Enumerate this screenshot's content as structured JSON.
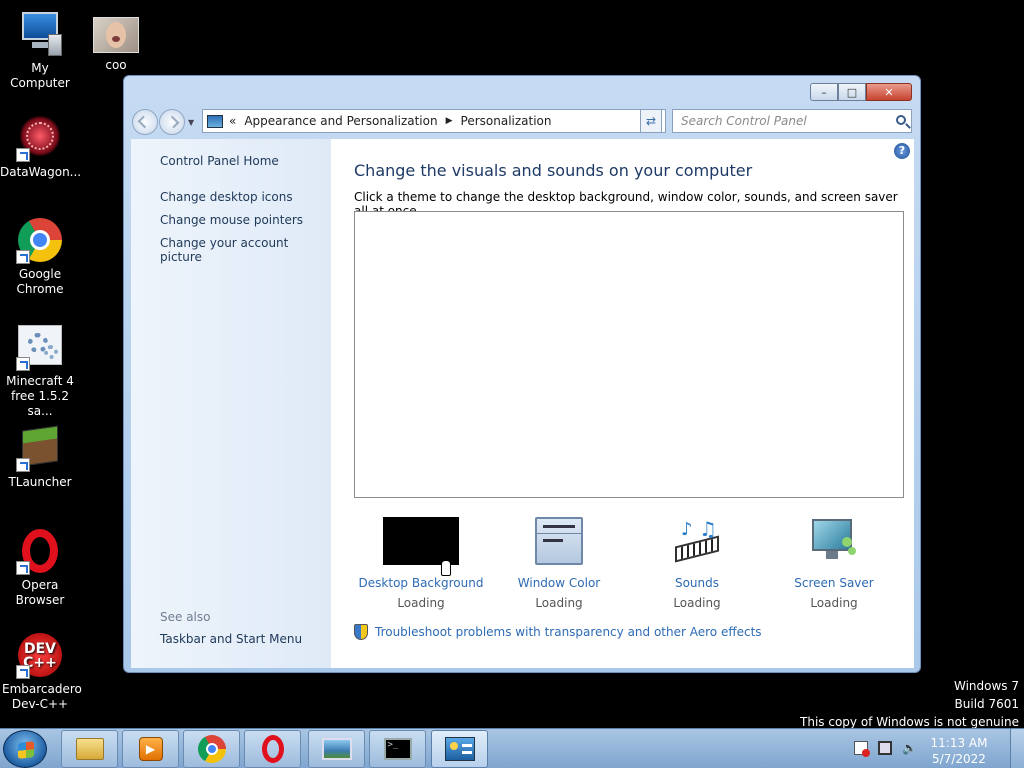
{
  "desktop": {
    "icons": [
      {
        "label": "My Computer"
      },
      {
        "label": "coo"
      },
      {
        "label": "DataWagon..."
      },
      {
        "label": "Google Chrome"
      },
      {
        "label": "Minecraft 4 free 1.5.2 sa..."
      },
      {
        "label": "TLauncher"
      },
      {
        "label": "Opera Browser"
      },
      {
        "label": "Embarcadero Dev-C++"
      }
    ]
  },
  "window": {
    "caption": {
      "minimize": "–",
      "maximize": "□",
      "close": "✕"
    },
    "address": {
      "prefix": "«",
      "crumbs": [
        "Appearance and Personalization",
        "Personalization"
      ],
      "separator": "▶"
    },
    "search": {
      "placeholder": "Search Control Panel"
    },
    "left_pane": {
      "home": "Control Panel Home",
      "links": [
        "Change desktop icons",
        "Change mouse pointers",
        "Change your account picture"
      ],
      "see_also": "See also",
      "see_also_links": [
        "Taskbar and Start Menu"
      ]
    },
    "main": {
      "help": "?",
      "heading": "Change the visuals and sounds on your computer",
      "subtitle": "Click a theme to change the desktop background, window color, sounds, and screen saver all at once.",
      "tiles": [
        {
          "label": "Desktop Background",
          "status": "Loading"
        },
        {
          "label": "Window Color",
          "status": "Loading"
        },
        {
          "label": "Sounds",
          "status": "Loading"
        },
        {
          "label": "Screen Saver",
          "status": "Loading"
        }
      ],
      "troubleshoot": "Troubleshoot problems with transparency and other Aero effects"
    }
  },
  "watermark": {
    "line1": "Windows 7",
    "line2": "Build 7601",
    "line3": "This copy of Windows is not genuine"
  },
  "taskbar": {
    "pinned": [
      "file-explorer-icon",
      "media-player-icon",
      "chrome-icon",
      "opera-icon",
      "photo-viewer-icon",
      "command-prompt-icon",
      "control-panel-icon"
    ],
    "clock": {
      "time": "11:13 AM",
      "date": "5/7/2022"
    }
  }
}
